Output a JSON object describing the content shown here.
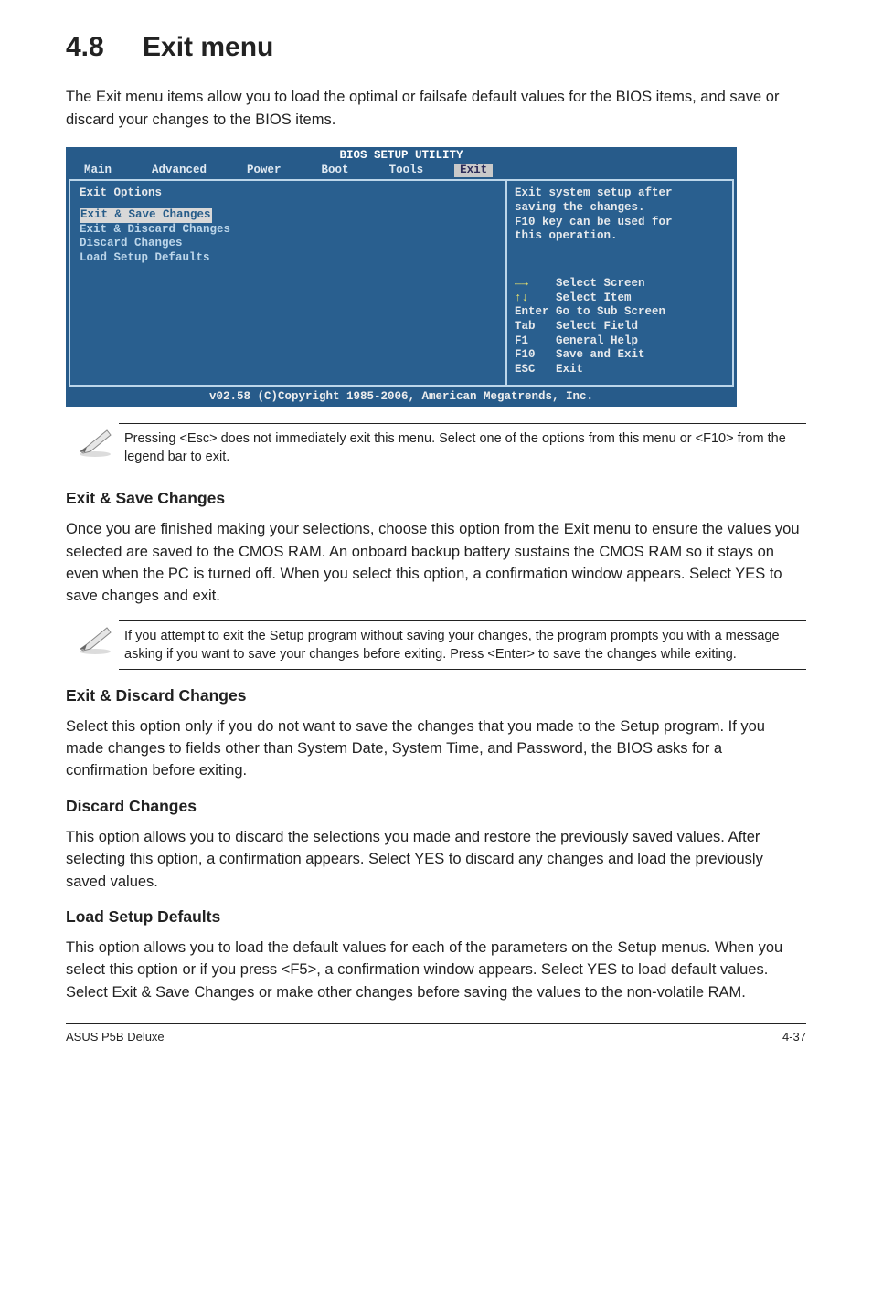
{
  "heading": {
    "number": "4.8",
    "title": "Exit menu"
  },
  "intro": "The Exit menu items allow you to load the optimal or failsafe default values for the BIOS items, and save or discard your changes to the BIOS items.",
  "bios": {
    "title": "BIOS SETUP UTILITY",
    "tabs": [
      "Main",
      "Advanced",
      "Power",
      "Boot",
      "Tools",
      "Exit"
    ],
    "active_tab": "Exit",
    "left": {
      "header": "Exit Options",
      "highlight": "Exit & Save Changes",
      "items": [
        "Exit & Discard Changes",
        "Discard Changes",
        "",
        "Load Setup Defaults"
      ]
    },
    "help": [
      "Exit system setup after",
      "saving the changes.",
      "",
      "F10 key can be used for",
      "this operation."
    ],
    "keys": [
      {
        "sym": "←→",
        "label": "Select Screen"
      },
      {
        "sym": "↑↓",
        "label": "Select Item"
      },
      {
        "sym": "Enter",
        "label": "Go to Sub Screen"
      },
      {
        "sym": "Tab",
        "label": "Select Field"
      },
      {
        "sym": "F1",
        "label": "General Help"
      },
      {
        "sym": "F10",
        "label": "Save and Exit"
      },
      {
        "sym": "ESC",
        "label": "Exit"
      }
    ],
    "footer": "v02.58 (C)Copyright 1985-2006, American Megatrends, Inc."
  },
  "note1": "Pressing <Esc> does not immediately exit this menu. Select one of the options from this menu or <F10> from the legend bar to exit.",
  "sections": {
    "s1": {
      "title": "Exit & Save Changes",
      "body": "Once you are finished making your selections, choose this option from the Exit menu to ensure the values you selected are saved to the CMOS RAM. An onboard backup battery sustains the CMOS RAM so it stays on even when the PC is turned off. When you select this option, a confirmation window appears. Select YES to save changes and exit."
    },
    "note2": " If you attempt to exit the Setup program without saving your changes, the program prompts you with a message asking if you want to save your changes before exiting. Press <Enter>  to save the  changes while exiting.",
    "s2": {
      "title": "Exit & Discard Changes",
      "body": "Select this option only if you do not want to save the changes that you  made to the Setup program. If you made changes to fields other than System Date, System Time, and Password, the BIOS asks for a confirmation before exiting."
    },
    "s3": {
      "title": "Discard Changes",
      "body": "This option allows you to discard the selections you made and restore the previously saved values. After selecting this option, a confirmation appears. Select YES to discard any changes and load the previously saved values."
    },
    "s4": {
      "title": "Load Setup Defaults",
      "body": "This option allows you to load the default values for each of the parameters on the Setup menus. When you select this option or if you press <F5>, a confirmation window appears. Select YES to load default values. Select Exit & Save Changes or make other changes before saving the values to the non-volatile RAM."
    }
  },
  "footer": {
    "left": "ASUS P5B Deluxe",
    "right": "4-37"
  }
}
